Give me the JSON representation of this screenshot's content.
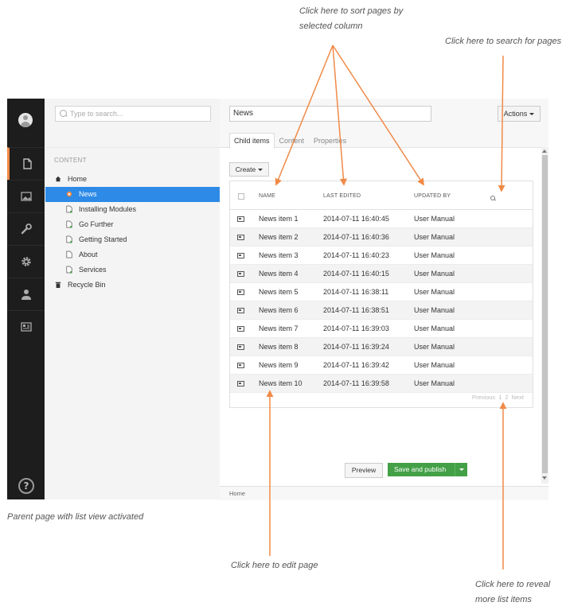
{
  "annotations": {
    "sort_line1": "Click here to sort pages by",
    "sort_line2": "selected column",
    "search": "Click here to search for pages",
    "caption": "Parent page with list view activated",
    "edit": "Click here to edit page",
    "reveal_line1": "Click here to reveal",
    "reveal_line2": "more list items"
  },
  "colors": {
    "accent_orange": "#f08a47",
    "selected_blue": "#2d8ae6",
    "publish_green": "#43a047",
    "sidebar_dark": "#1d1d1d"
  },
  "sidebar_icons": [
    "avatar-icon",
    "document-icon",
    "media-icon",
    "wrench-icon",
    "gear-icon",
    "user-icon",
    "id-card-icon",
    "help-icon"
  ],
  "tree": {
    "search_placeholder": "Type to search...",
    "section_label": "CONTENT",
    "items": [
      {
        "label": "Home",
        "icon": "home-icon"
      },
      {
        "label": "News",
        "icon": "folder-icon"
      },
      {
        "label": "Installing Modules",
        "icon": "page-icon"
      },
      {
        "label": "Go Further",
        "icon": "page-icon"
      },
      {
        "label": "Getting Started",
        "icon": "page-icon"
      },
      {
        "label": "About",
        "icon": "page-icon"
      },
      {
        "label": "Services",
        "icon": "page-icon"
      },
      {
        "label": "Recycle Bin",
        "icon": "trash-icon"
      }
    ]
  },
  "editor": {
    "name_value": "News",
    "actions_label": "Actions",
    "tabs": [
      "Child items",
      "Content",
      "Properties"
    ],
    "create_label": "Create",
    "columns": [
      "NAME",
      "LAST EDITED",
      "UPDATED BY"
    ],
    "rows": [
      {
        "name": "News item 1",
        "edited": "2014-07-11 16:40:45",
        "by": "User Manual"
      },
      {
        "name": "News item 2",
        "edited": "2014-07-11 16:40:36",
        "by": "User Manual"
      },
      {
        "name": "News item 3",
        "edited": "2014-07-11 16:40:23",
        "by": "User Manual"
      },
      {
        "name": "News item 4",
        "edited": "2014-07-11 16:40:15",
        "by": "User Manual"
      },
      {
        "name": "News item 5",
        "edited": "2014-07-11 16:38:11",
        "by": "User Manual"
      },
      {
        "name": "News item 6",
        "edited": "2014-07-11 16:38:51",
        "by": "User Manual"
      },
      {
        "name": "News item 7",
        "edited": "2014-07-11 16:39:03",
        "by": "User Manual"
      },
      {
        "name": "News item 8",
        "edited": "2014-07-11 16:39:24",
        "by": "User Manual"
      },
      {
        "name": "News item 9",
        "edited": "2014-07-11 16:39:42",
        "by": "User Manual"
      },
      {
        "name": "News item 10",
        "edited": "2014-07-11 16:39:58",
        "by": "User Manual"
      }
    ],
    "pager": {
      "previous": "Previous",
      "page1": "1",
      "page2": "2",
      "next": "Next"
    },
    "preview_label": "Preview",
    "save_label": "Save and publish",
    "breadcrumb": "Home"
  }
}
